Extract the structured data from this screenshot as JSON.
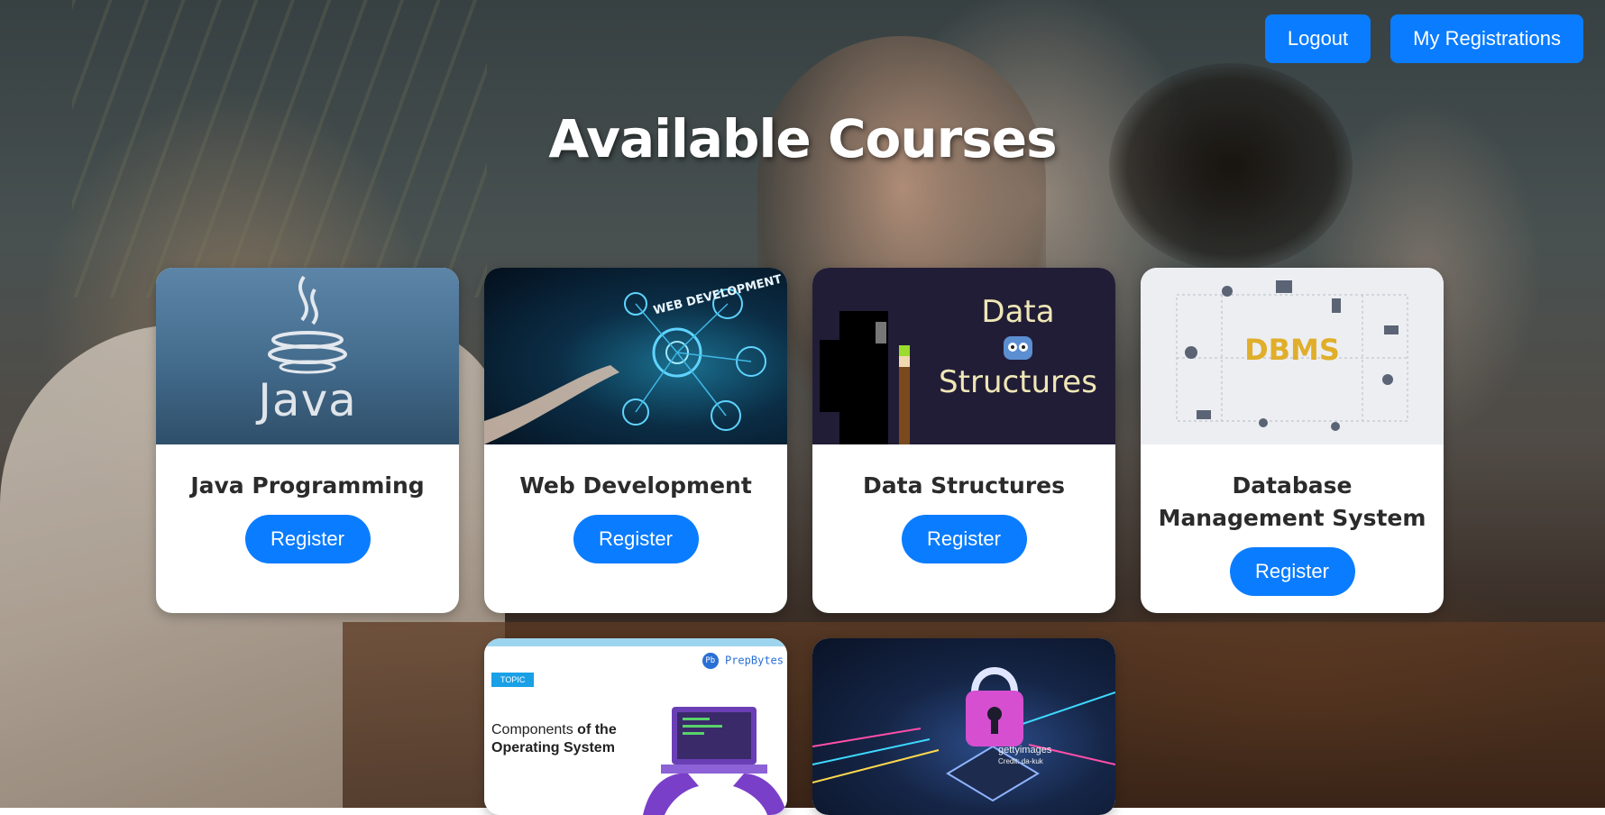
{
  "header": {
    "logout_label": "Logout",
    "my_registrations_label": "My Registrations",
    "accent_color": "#0a7cff"
  },
  "page": {
    "title": "Available Courses"
  },
  "courses": [
    {
      "title": "Java Programming",
      "register_label": "Register",
      "thumbnail": {
        "icon": "java-coffee-cup-logo",
        "text": "Java"
      }
    },
    {
      "title": "Web Development",
      "register_label": "Register",
      "thumbnail": {
        "icon": "web-network-hand",
        "text": "WEB DEVELOPMENT"
      }
    },
    {
      "title": "Data Structures",
      "register_label": "Register",
      "thumbnail": {
        "icon": "robot-blocks",
        "text_line1": "Data",
        "text_line2": "Structures"
      }
    },
    {
      "title": "Database Management System",
      "register_label": "Register",
      "thumbnail": {
        "icon": "database-network-icons",
        "text": "DBMS"
      }
    },
    {
      "title": "",
      "thumbnail": {
        "icon": "laptop-typing",
        "tag": "TOPIC",
        "brand": "PrepBytes",
        "headline_part1": "Components ",
        "headline_part2": "of the",
        "headline_part3": "Operating System"
      }
    },
    {
      "title": "",
      "thumbnail": {
        "icon": "padlock-circuit",
        "brand": "gettyimages",
        "credit": "Credit: da-kuk"
      }
    }
  ]
}
